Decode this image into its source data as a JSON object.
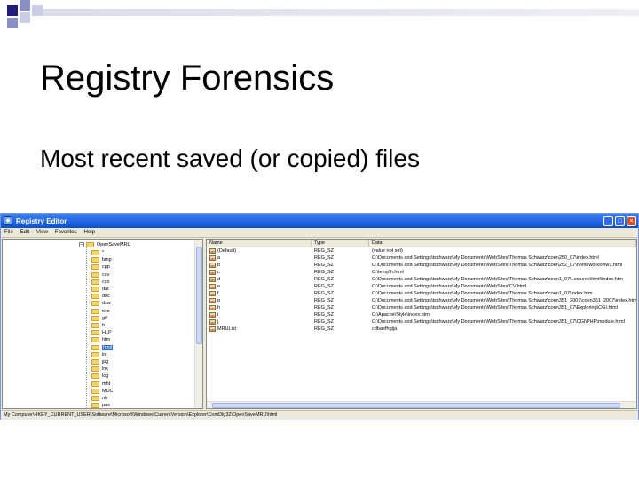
{
  "slide": {
    "title": "Registry Forensics",
    "bullet": "Most recent saved (or copied) files"
  },
  "colors": {
    "accent_dark": "#1f1f7a",
    "accent_mid": "#8a8fc6",
    "titlebar": "#0f4fd0",
    "selection": "#316ac5"
  },
  "window": {
    "title": "Registry Editor",
    "minimize": "_",
    "maximize": "□",
    "close": "×",
    "menu": [
      "File",
      "Edit",
      "View",
      "Favorites",
      "Help"
    ]
  },
  "tree": {
    "root": "OpenSaveMRU",
    "items": [
      "*",
      "bmp",
      "cpp",
      "csv",
      "cxx",
      "dat",
      "doc",
      "dsw",
      "exe",
      "gif",
      "h",
      "HLP",
      "htm",
      "html",
      "ini",
      "jpg",
      "lnk",
      "log",
      "mht",
      "MDC",
      "nh",
      "pas"
    ],
    "selected_index": 13
  },
  "list": {
    "columns": [
      "Name",
      "Type",
      "Data"
    ],
    "rows": [
      {
        "name": "(Default)",
        "type": "REG_SZ",
        "data": "(value not set)"
      },
      {
        "name": "a",
        "type": "REG_SZ",
        "data": "C:\\Documents and Settings\\tschwarz\\My Documents\\WebSites\\Thomas Schwarz\\coen250_07\\index.html"
      },
      {
        "name": "b",
        "type": "REG_SZ",
        "data": "C:\\Documents and Settings\\tschwarz\\My Documents\\WebSites\\Thomas Schwarz\\coen252_07\\homeworks\\hw1.html"
      },
      {
        "name": "c",
        "type": "REG_SZ",
        "data": "C:\\temp\\h.html"
      },
      {
        "name": "d",
        "type": "REG_SZ",
        "data": "C:\\Documents and Settings\\tschwarz\\My Documents\\WebSites\\Thomas Schwarz\\coen1_07\\Lectures\\html\\index.htm"
      },
      {
        "name": "e",
        "type": "REG_SZ",
        "data": "C:\\Documents and Settings\\tschwarz\\My Documents\\WebSites\\CV.html"
      },
      {
        "name": "f",
        "type": "REG_SZ",
        "data": "C:\\Documents and Settings\\tschwarz\\My Documents\\WebSites\\Thomas Schwarz\\coen1_07\\index.htm"
      },
      {
        "name": "g",
        "type": "REG_SZ",
        "data": "C:\\Documents and Settings\\tschwarz\\My Documents\\WebSites\\Thomas Schwarz\\coen351_2007\\coen351_2007\\index.html"
      },
      {
        "name": "h",
        "type": "REG_SZ",
        "data": "C:\\Documents and Settings\\tschwarz\\My Documents\\WebSites\\Thomas Schwarz\\coen351_07\\Exploring\\CGI.html"
      },
      {
        "name": "i",
        "type": "REG_SZ",
        "data": "C:\\Apache\\Style\\index.htm"
      },
      {
        "name": "j",
        "type": "REG_SZ",
        "data": "C:\\Documents and Settings\\tschwarz\\My Documents\\WebSites\\Thomas Schwarz\\coen351_07\\CGI\\PHP\\module.html"
      },
      {
        "name": "MRUList",
        "type": "REG_SZ",
        "data": "cdbaefhgija"
      }
    ]
  },
  "statusbar": {
    "path": "My Computer\\HKEY_CURRENT_USER\\Software\\Microsoft\\Windows\\CurrentVersion\\Explorer\\ComDlg32\\OpenSaveMRU\\html"
  }
}
